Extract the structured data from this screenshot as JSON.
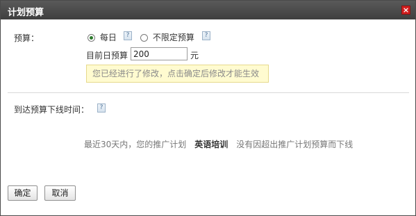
{
  "dialog": {
    "title": "计划预算",
    "close_label": "×"
  },
  "budget": {
    "label": "预算：",
    "options": [
      {
        "label": "每日",
        "selected": true
      },
      {
        "label": "不限定预算",
        "selected": false
      }
    ],
    "daily_label": "目前日预算",
    "daily_value": "200",
    "unit": "元",
    "notice": "您已经进行了修改，点击确定后修改才能生效"
  },
  "offline": {
    "label": "到达预算下线时间：",
    "status_prefix": "最近30天内，您的推广计划",
    "plan_name": "英语培训",
    "status_suffix": "没有因超出推广计划预算而下线"
  },
  "help_icon_text": "?",
  "buttons": {
    "confirm": "确定",
    "cancel": "取消"
  },
  "colors": {
    "titlebar": "#4a4a4a",
    "close": "#d21f1f",
    "notice_bg": "#fffbd0"
  },
  "icons": {
    "close": "close-icon",
    "help": "help-icon",
    "radio": "radio-icon"
  }
}
